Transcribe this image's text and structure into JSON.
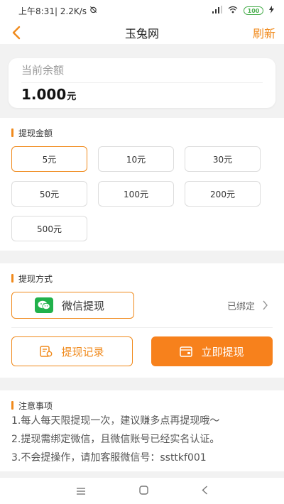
{
  "status_bar": {
    "left_text": "上午8:31| 2.2K/s",
    "battery": "100"
  },
  "nav": {
    "title": "玉兔网",
    "refresh_label": "刷新"
  },
  "balance": {
    "label": "当前余额",
    "value": "1.000",
    "unit": "元"
  },
  "amount_section": {
    "title": "提现金额",
    "selected_index": 0,
    "options": [
      "5元",
      "10元",
      "30元",
      "50元",
      "100元",
      "200元",
      "500元"
    ]
  },
  "method_section": {
    "title": "提现方式",
    "wechat_label": "微信提现",
    "bound_status": "已绑定"
  },
  "actions": {
    "record_label": "提现记录",
    "withdraw_label": "立即提现"
  },
  "notes_section": {
    "title": "注意事项",
    "lines": [
      "1.每人每天限提现一次，建议赚多点再提现哦～",
      "2.提现需绑定微信，且微信账号已经实名认证。",
      "3.不会提操作，请加客服微信号：ssttkf001"
    ]
  },
  "colors": {
    "accent": "#f08a1c",
    "primary_button": "#f7811c",
    "wechat_green": "#21b14b",
    "page_background": "#f2f2f2"
  },
  "icons": {
    "back": "chevron-left-icon",
    "wechat": "wechat-logo-icon",
    "record": "record-icon",
    "wallet": "wallet-icon",
    "more": "chevron-right-icon",
    "home": "square-home-icon",
    "menu": "menu-lines-icon",
    "nav_back": "triangle-back-icon"
  }
}
